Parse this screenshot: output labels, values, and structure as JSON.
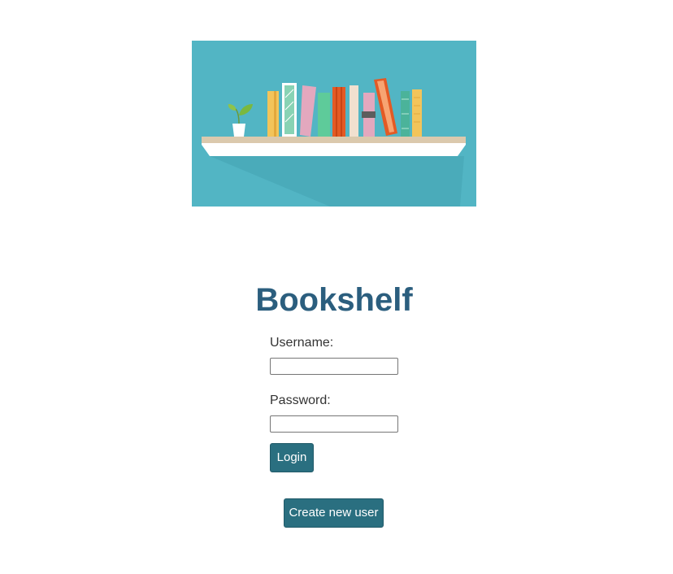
{
  "banner": {
    "alt": "Bookshelf illustration",
    "background_color": "#52b5c4"
  },
  "app": {
    "title": "Bookshelf"
  },
  "login_form": {
    "username_label": "Username:",
    "username_value": "",
    "password_label": "Password:",
    "password_value": "",
    "login_label": "Login"
  },
  "actions": {
    "create_user_label": "Create new user"
  },
  "colors": {
    "title": "#2b5e7e",
    "button": "#2a6f80",
    "button_text": "#ffffff"
  }
}
